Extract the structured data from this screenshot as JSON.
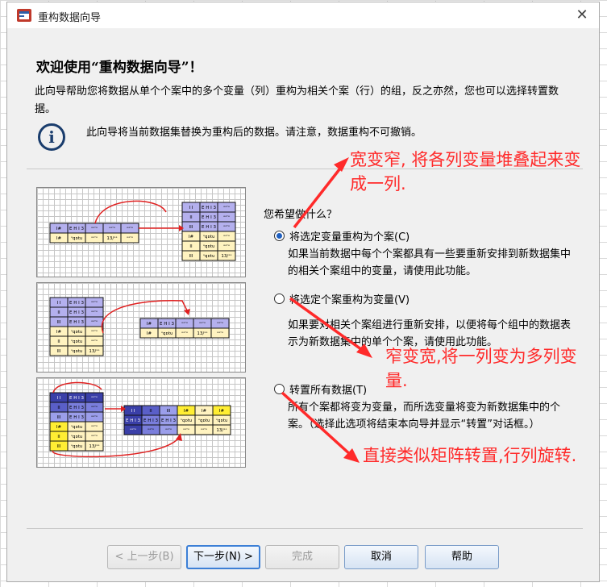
{
  "window": {
    "title": "重构数据向导",
    "close_glyph": "✕"
  },
  "header": {
    "welcome": "欢迎使用“重构数据向导”！",
    "description": "此向导帮助您将数据从单个个案中的多个变量（列）重构为相关个案（行）的组，反之亦然，您也可以选择转置数据。",
    "info_text": "此向导将当前数据集替换为重构后的数据。请注意，数据重构不可撤销。",
    "info_glyph": "i"
  },
  "question": "您希望做什么？",
  "options": [
    {
      "label": "将选定变量重构为个案(C)",
      "checked": true,
      "description": "如果当前数据中每个个案都具有一些要重新安排到新数据集中的相关个案组中的变量，请使用此功能。"
    },
    {
      "label": "将选定个案重构为变量(V)",
      "checked": false,
      "description": "如果要对相关个案组进行重新安排，以便将每个组中的数据表示为新数据集中的单个个案，请使用此功能。"
    },
    {
      "label": "转置所有数据(T)",
      "checked": false,
      "description": "所有个案都将变为变量，而所选变量将变为新数据集中的个案。（选择此选项将结束本向导并显示“转置”对话框。）"
    }
  ],
  "illustration_cells": {
    "a": "I I",
    "b": "E H I 3",
    "c": "ᐤᐤ'ᐤ",
    "d": "I#",
    "e": "ᐤqᴅtᴜ",
    "f": "13/ᐤᐤ",
    "g": "II",
    "h": "III"
  },
  "buttons": {
    "back": "< 上一步(B)",
    "next": "下一步(N) >",
    "finish": "完成",
    "cancel": "取消",
    "help": "帮助"
  },
  "annotations": {
    "note1": "宽变窄, 将各列变量堆叠起来变成一列.",
    "note2": "窄变宽,将一列变为多列变量.",
    "note3": "直接类似矩阵转置,行列旋转."
  },
  "colors": {
    "annotation": "#ff2a2a",
    "cell_purple": "#b4b0ee",
    "cell_cream": "#fff3c0",
    "cell_dark_blue": "#3a3fa8",
    "cell_yellow": "#ffee33"
  }
}
